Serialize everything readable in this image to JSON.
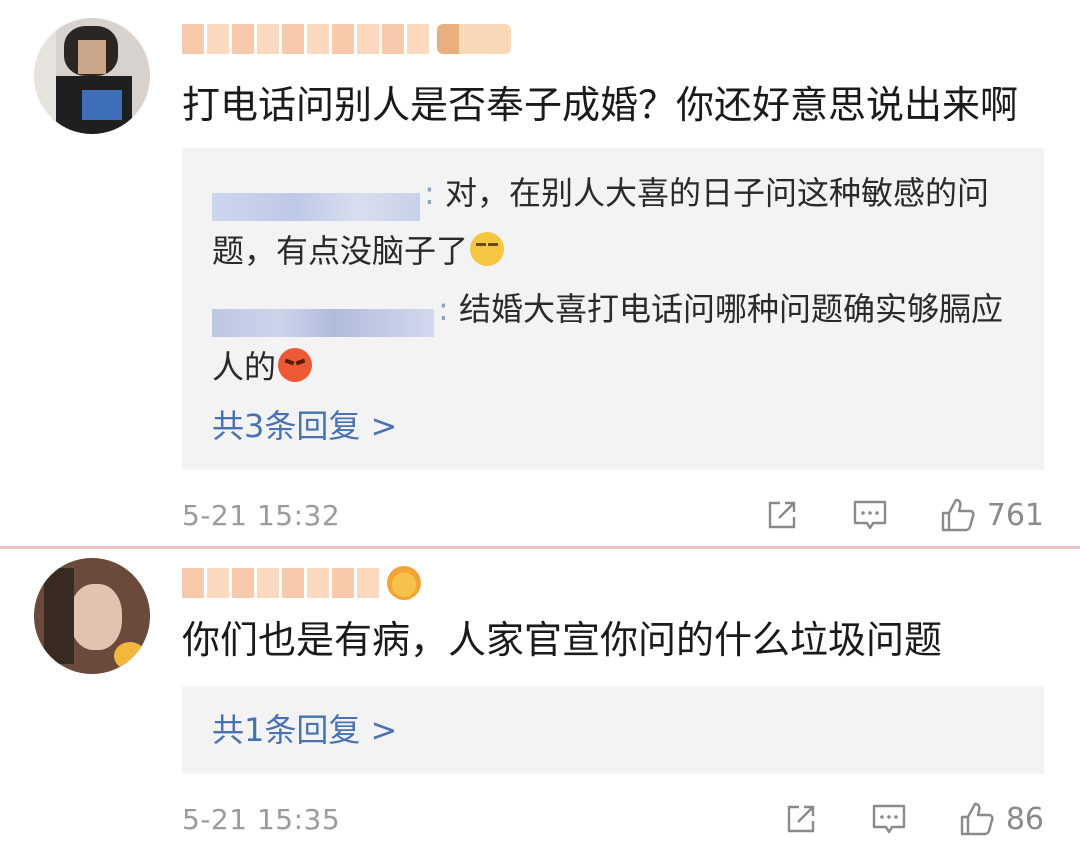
{
  "comments": [
    {
      "text": "打电话问别人是否奉子成婚？你还好意思说出来啊",
      "replies": [
        {
          "text": "对，在别人大喜的日子问这种敏感的问题，有点没脑子了",
          "emoji": "sweat-emoji"
        },
        {
          "text": "结婚大喜打电话问哪种问题确实够膈应人的",
          "emoji": "angry-emoji"
        }
      ],
      "more_replies": "共3条回复 >",
      "timestamp": "5-21 15:32",
      "like_count": "761"
    },
    {
      "text": "你们也是有病，人家官宣你问的什么垃圾问题",
      "more_replies": "共1条回复 >",
      "timestamp": "5-21 15:35",
      "like_count": "86"
    }
  ],
  "colors": {
    "link": "#4a72b0",
    "reply_bg": "#f3f3f3",
    "divider": "#e8c2c4",
    "meta_text": "#9b9b9b"
  },
  "icons": [
    "share-icon",
    "comment-icon",
    "like-icon"
  ]
}
